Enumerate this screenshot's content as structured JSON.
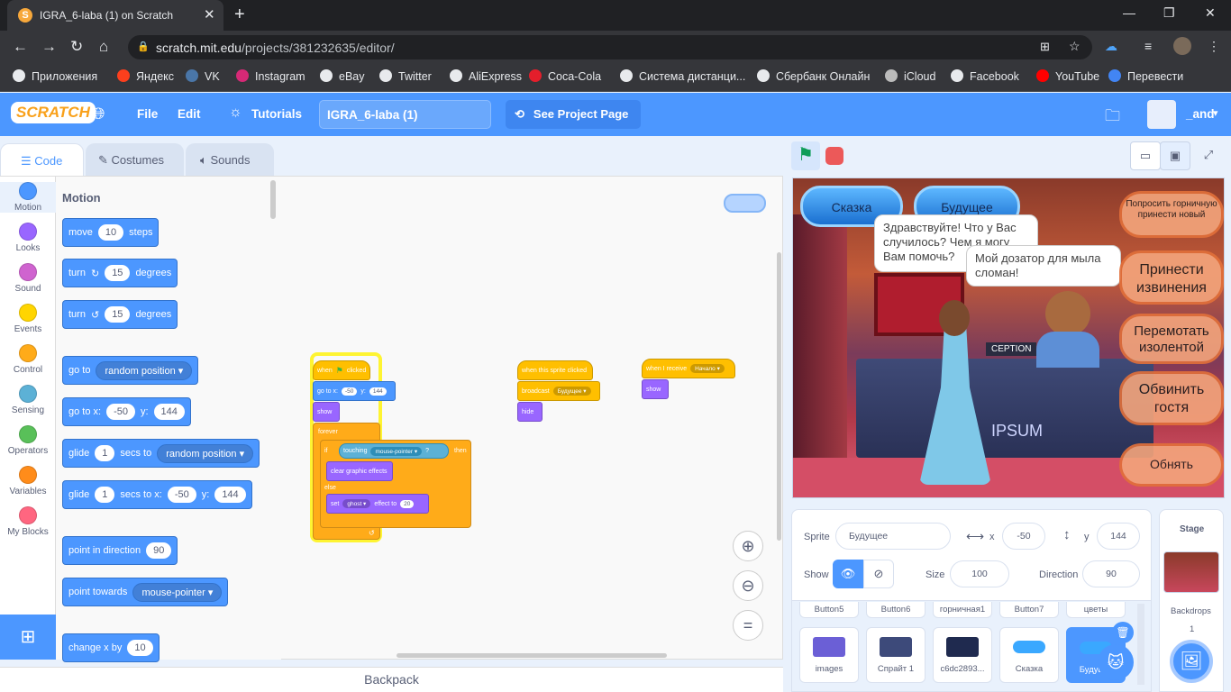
{
  "browser": {
    "tab_title": "IGRA_6-laba (1) on Scratch",
    "url_host": "scratch.mit.edu",
    "url_path": "/projects/381232635/editor/",
    "bookmarks": [
      "Приложения",
      "Яндекс",
      "VK",
      "Instagram",
      "eBay",
      "Twitter",
      "AliExpress",
      "Coca-Cola",
      "Система дистанци...",
      "Сбербанк Онлайн",
      "iCloud",
      "Facebook",
      "YouTube",
      "Перевести"
    ]
  },
  "menu": {
    "logo": "SCRATCH",
    "file": "File",
    "edit": "Edit",
    "tutorials": "Tutorials",
    "project_title": "IGRA_6-laba (1)",
    "see_project": "See Project Page",
    "user": "_and"
  },
  "tabs": {
    "code": "Code",
    "costumes": "Costumes",
    "sounds": "Sounds"
  },
  "categories": [
    {
      "label": "Motion",
      "color": "#4c97ff"
    },
    {
      "label": "Looks",
      "color": "#9966ff"
    },
    {
      "label": "Sound",
      "color": "#cf63cf"
    },
    {
      "label": "Events",
      "color": "#ffd500"
    },
    {
      "label": "Control",
      "color": "#ffab19"
    },
    {
      "label": "Sensing",
      "color": "#5cb1d6"
    },
    {
      "label": "Operators",
      "color": "#59c059"
    },
    {
      "label": "Variables",
      "color": "#ff8c1a"
    },
    {
      "label": "My Blocks",
      "color": "#ff6680"
    }
  ],
  "palette": {
    "title": "Motion",
    "move": {
      "a": "move",
      "v": "10",
      "b": "steps"
    },
    "turn_cw": {
      "a": "turn",
      "v": "15",
      "b": "degrees"
    },
    "turn_ccw": {
      "a": "turn",
      "v": "15",
      "b": "degrees"
    },
    "goto": {
      "a": "go to",
      "dd": "random position"
    },
    "gotoxy": {
      "a": "go to x:",
      "x": "-50",
      "b": "y:",
      "y": "144"
    },
    "glide": {
      "a": "glide",
      "v": "1",
      "b": "secs to",
      "dd": "random position"
    },
    "glidexy": {
      "a": "glide",
      "v": "1",
      "b": "secs to x:",
      "x": "-50",
      "c": "y:",
      "y": "144"
    },
    "point": {
      "a": "point in direction",
      "v": "90"
    },
    "towards": {
      "a": "point towards",
      "dd": "mouse-pointer"
    },
    "changex": {
      "a": "change x by",
      "v": "10"
    }
  },
  "scripts": {
    "s1": {
      "hat": "when",
      "hat_b": "clicked",
      "goto": "go to x:",
      "x": "-50",
      "y_lbl": "y:",
      "y": "144",
      "show": "show",
      "forever": "forever",
      "if": "if",
      "touching": "touching",
      "touching_dd": "mouse-pointer",
      "q": "?",
      "then": "then",
      "clear": "clear graphic effects",
      "else": "else",
      "set": "set",
      "set_dd": "ghost",
      "effect": "effect to",
      "effect_v": "20"
    },
    "s2": {
      "hat": "when this sprite clicked",
      "broadcast": "broadcast",
      "broadcast_dd": "Будущее",
      "hide": "hide"
    },
    "s3": {
      "hat": "when I receive",
      "dd": "Начало",
      "show": "show"
    }
  },
  "backpack": "Backpack",
  "stage": {
    "btn_skazka": "Сказка",
    "btn_budushee": "Будущее",
    "bubble1": "Здравствуйте! Что у Вас случилось? Чем я могу Вам помочь?",
    "bubble2": "Мой дозатор для мыла сломан!",
    "opt1": "Попросить горничную принести новый",
    "opt2": "Принести извинения",
    "opt3": "Перемотать изолентой",
    "opt4": "Обвинить гостя",
    "opt5": "Обнять",
    "reception": "CEPTION",
    "ipsum": "IPSUM"
  },
  "sprite_info": {
    "sprite_lbl": "Sprite",
    "sprite_name": "Будущее",
    "x_lbl": "x",
    "x": "-50",
    "y_lbl": "y",
    "y": "144",
    "show_lbl": "Show",
    "size_lbl": "Size",
    "size": "100",
    "direction_lbl": "Direction",
    "direction": "90"
  },
  "sprite_row1": [
    "Button5",
    "Button6",
    "горничная1",
    "Button7",
    "цветы"
  ],
  "sprite_row2": [
    "images",
    "Спрайт 1",
    "c6dc2893...",
    "Сказка",
    "Будущ..."
  ],
  "stage_pane": {
    "title": "Stage",
    "backdrops": "Backdrops",
    "count": "1"
  }
}
